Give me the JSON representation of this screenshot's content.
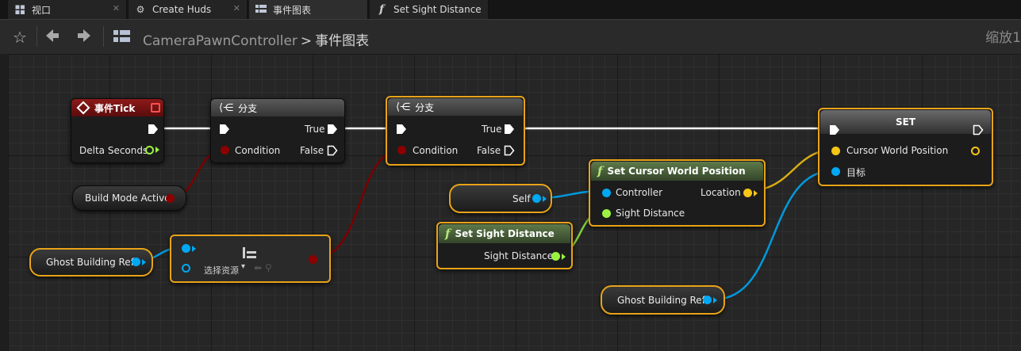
{
  "tabs": [
    {
      "label": "视口",
      "icon": "viewport-icon"
    },
    {
      "label": "Create Huds",
      "icon": "gear-icon"
    },
    {
      "label": "事件图表",
      "icon": "event-graph-icon"
    },
    {
      "label": "Set Sight Distance",
      "icon": "function-icon"
    }
  ],
  "breadcrumb": {
    "blueprint": "CameraPawnController",
    "graph": "事件图表"
  },
  "zoom_label": "缩放1",
  "nodes": {
    "event_tick": {
      "title": "事件Tick",
      "pin_delta": "Delta Seconds"
    },
    "branch1": {
      "title": "分支",
      "pin_condition": "Condition",
      "pin_true": "True",
      "pin_false": "False"
    },
    "branch2": {
      "title": "分支",
      "pin_condition": "Condition",
      "pin_true": "True",
      "pin_false": "False"
    },
    "build_mode": {
      "label": "Build Mode Active"
    },
    "ghost_ref_1": {
      "label": "Ghost Building Ref"
    },
    "isvalid": {
      "asset_placeholder": "选择资源"
    },
    "self_ref": {
      "label": "Self"
    },
    "set_cursor": {
      "title": "Set Cursor World Position",
      "pin_controller": "Controller",
      "pin_sight": "Sight Distance",
      "pin_location": "Location"
    },
    "set_sight": {
      "title": "Set Sight Distance",
      "pin_sight": "Sight Distance"
    },
    "set_var": {
      "title": "SET",
      "pin_cursor": "Cursor World Position",
      "pin_target": "目标"
    },
    "ghost_ref_2": {
      "label": "Ghost Building Ref"
    }
  },
  "colors": {
    "exec": "#ffffff",
    "bool": "#8c0000",
    "object": "#00a8f3",
    "vector": "#f5c518",
    "float": "#9cf242",
    "selection": "#e8a318",
    "event_header": "#7a1010",
    "branch_header": "#444444",
    "function_header": "#4a6b3a"
  }
}
